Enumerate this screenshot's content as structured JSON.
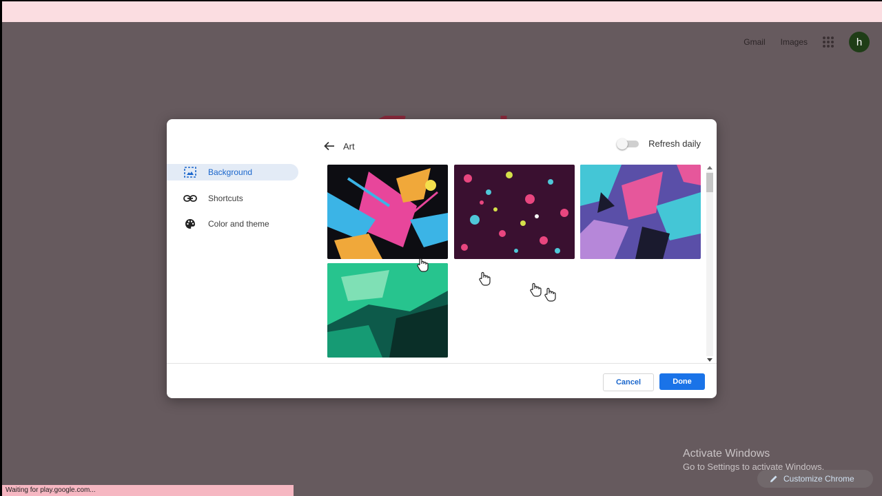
{
  "topbar": {
    "gmail_label": "Gmail",
    "images_label": "Images",
    "avatar_letter": "h"
  },
  "dialog": {
    "header_title": "Art",
    "refresh_label": "Refresh daily",
    "refresh_enabled": false,
    "nav": [
      {
        "label": "Background",
        "icon": "background-icon",
        "active": true
      },
      {
        "label": "Shortcuts",
        "icon": "link-icon",
        "active": false
      },
      {
        "label": "Color and theme",
        "icon": "palette-icon",
        "active": false
      }
    ],
    "thumbnails": [
      {
        "name": "art-thumbnail-1",
        "colors": [
          "#0d0d12",
          "#e8469b",
          "#3bb4e6",
          "#f0a83a"
        ]
      },
      {
        "name": "art-thumbnail-2",
        "colors": [
          "#3a1030",
          "#e8467f",
          "#4fc7d8",
          "#d4e04a"
        ]
      },
      {
        "name": "art-thumbnail-3",
        "colors": [
          "#5a4fa8",
          "#44c6d6",
          "#e6579b",
          "#1a1a2e"
        ]
      },
      {
        "name": "art-thumbnail-4",
        "colors": [
          "#0d5a4a",
          "#27c48e",
          "#7fe0b5",
          "#0a2f28"
        ]
      }
    ],
    "cancel_label": "Cancel",
    "done_label": "Done"
  },
  "watermark": {
    "title": "Activate Windows",
    "subtitle": "Go to Settings to activate Windows."
  },
  "customize_label": "Customize Chrome",
  "status_text": "Waiting for play.google.com...",
  "colors": {
    "backdrop": "#665a5e",
    "accent": "#1a73e8",
    "active_nav_bg": "#e3ebf6"
  }
}
